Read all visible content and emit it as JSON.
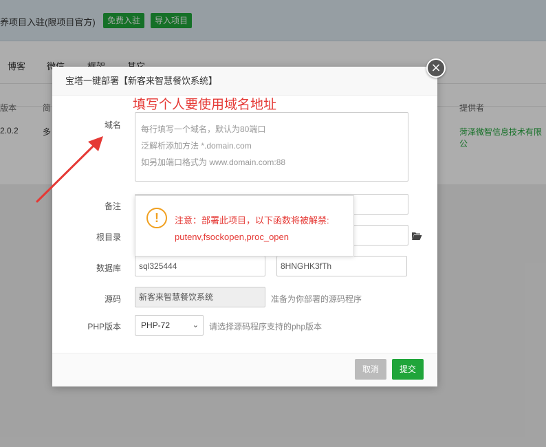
{
  "background": {
    "banner_text": "养项目入驻(限项目官方)",
    "free_join_button": "免费入驻",
    "import_button": "导入项目",
    "tabs": [
      "博客",
      "微信",
      "框架",
      "其它"
    ],
    "table_headers": [
      "版本",
      "简",
      "提供者"
    ],
    "row": {
      "version": "2.0.2",
      "desc": "多",
      "provider": "菏泽微智信息技术有限公"
    }
  },
  "modal": {
    "title": "宝塔一键部署【新客来智慧餐饮系统】",
    "annotation": "填写个人要使用域名地址",
    "fields": {
      "domain_label": "域名",
      "domain_placeholder_lines": [
        "每行填写一个域名，默认为80端口",
        "泛解析添加方法 *.domain.com",
        "如另加端口格式为 www.domain.com:88"
      ],
      "remark_label": "备注",
      "root_label": "根目录",
      "db_label": "数据库",
      "db_name": "sql325444",
      "db_password": "8HNGHK3fTh",
      "source_label": "源码",
      "source_value": "新客来智慧餐饮系统",
      "source_hint": "准备为你部署的源码程序",
      "php_label": "PHP版本",
      "php_value": "PHP-72",
      "php_hint": "请选择源码程序支持的php版本"
    },
    "warning": {
      "line1": "注意：部署此项目，以下函数将被解禁:",
      "line2": "putenv,fsockopen,proc_open"
    },
    "cancel_button": "取消",
    "submit_button": "提交"
  },
  "colors": {
    "accent": "#20a53a",
    "warning": "#e53935",
    "warn_icon": "#f0a020"
  }
}
